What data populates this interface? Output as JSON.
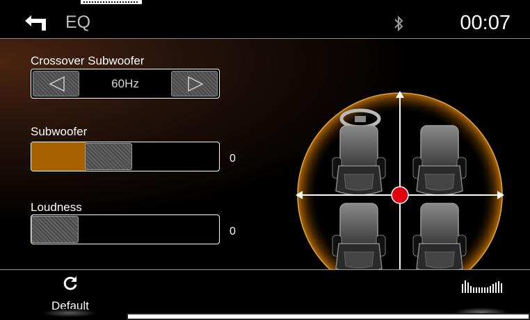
{
  "header": {
    "title": "EQ",
    "clock": "00:07"
  },
  "crossover": {
    "label": "Crossover Subwoofer",
    "value": "60Hz"
  },
  "subwoofer": {
    "label": "Subwoofer",
    "value": "0",
    "level_fraction": 0.38
  },
  "loudness": {
    "label": "Loudness",
    "value": "0",
    "level_fraction": 0
  },
  "footer": {
    "default_label": "Default"
  },
  "colors": {
    "accent": "#a86000",
    "balance_dot": "#e00010",
    "ring": "#d9a04a"
  },
  "icons": [
    "back-arrow-icon",
    "bluetooth-icon",
    "arrow-left-icon",
    "arrow-right-icon",
    "steering-wheel-icon",
    "car-seat-icon",
    "refresh-icon",
    "equalizer-icon"
  ]
}
